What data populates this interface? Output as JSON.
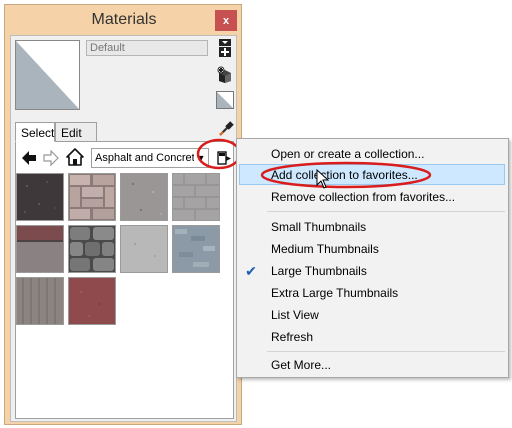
{
  "window": {
    "title": "Materials",
    "close_label": "x"
  },
  "material": {
    "name_value": "Default"
  },
  "tabs": [
    {
      "label": "Select"
    },
    {
      "label": "Edit"
    }
  ],
  "collection": {
    "selected": "Asphalt and Concrete"
  },
  "thumbnails": [
    {
      "name": "asphalt-dark",
      "color": "#3e383b"
    },
    {
      "name": "pavers-pink",
      "color": "#b9a39f"
    },
    {
      "name": "concrete-gray",
      "color": "#9a9696"
    },
    {
      "name": "pavers-gray",
      "color": "#a5a3a3"
    },
    {
      "name": "asphalt-red-stripe",
      "color": "#7a6e6e"
    },
    {
      "name": "cobblestone-gray",
      "color": "#6d6d6d"
    },
    {
      "name": "concrete-light",
      "color": "#b8b8b8"
    },
    {
      "name": "tiles-blue",
      "color": "#8b9aa6"
    },
    {
      "name": "concrete-scored",
      "color": "#8c8481"
    },
    {
      "name": "asphalt-red",
      "color": "#8e4a4d"
    }
  ],
  "menu": {
    "items": [
      {
        "label": "Open or create a collection..."
      },
      {
        "label": "Add collection to favorites..."
      },
      {
        "label": "Remove collection from favorites..."
      },
      {
        "label": "Small Thumbnails"
      },
      {
        "label": "Medium Thumbnails"
      },
      {
        "label": "Large Thumbnails"
      },
      {
        "label": "Extra Large Thumbnails"
      },
      {
        "label": "List View"
      },
      {
        "label": "Refresh"
      },
      {
        "label": "Get More..."
      }
    ],
    "checked_item": "Large Thumbnails"
  },
  "colors": {
    "window_frame": "#f5d2a7",
    "close_button": "#c75050",
    "highlight_fill": "#cde8ff",
    "highlight_border": "#99c9ef",
    "annotation_red": "#d91c1c"
  }
}
